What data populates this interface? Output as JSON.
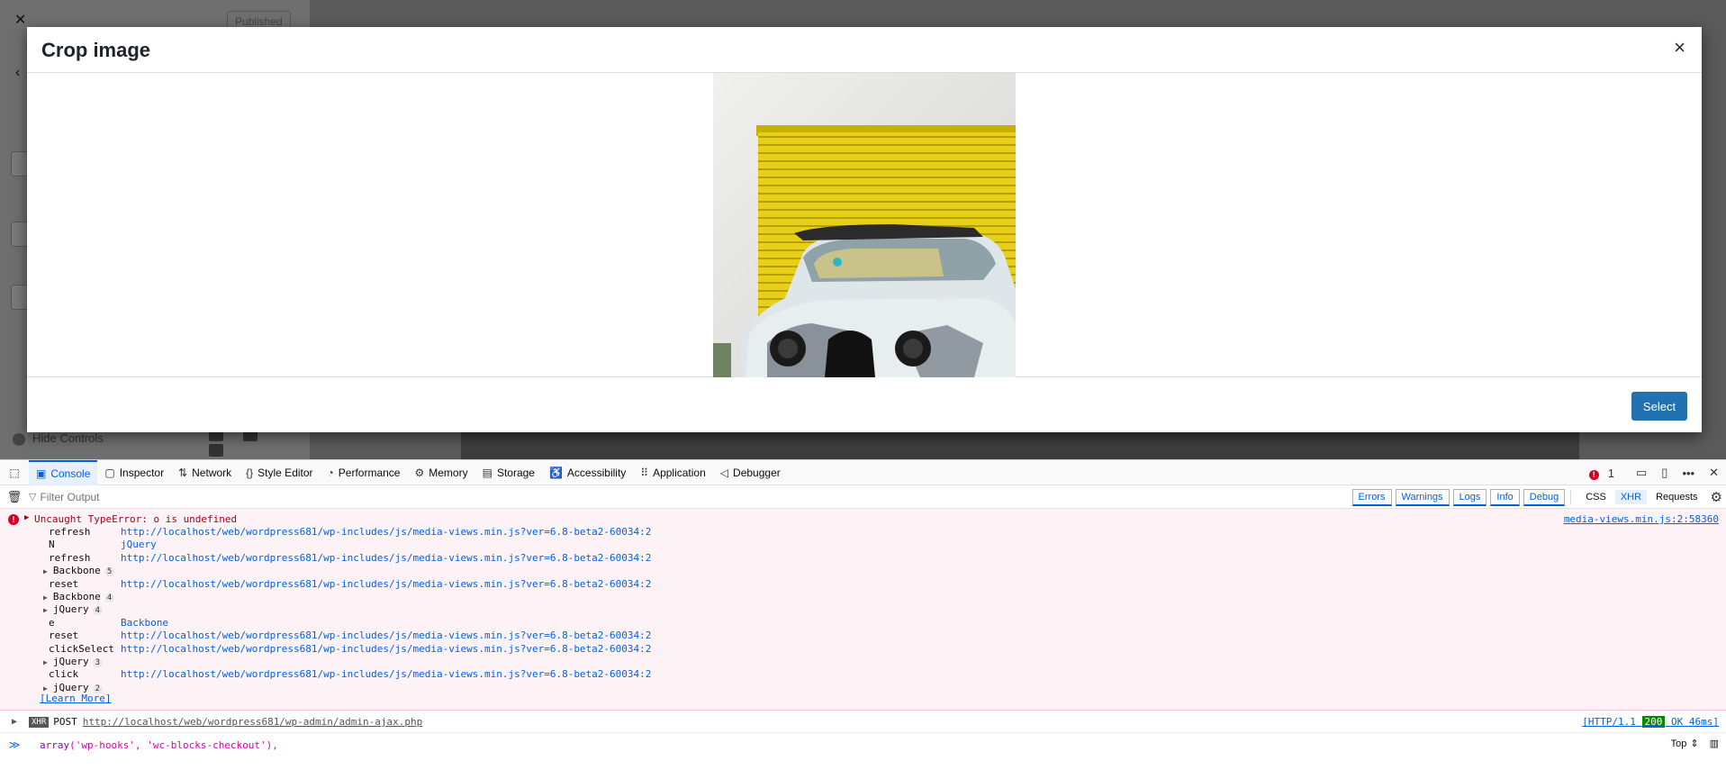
{
  "background": {
    "published_label": "Published",
    "hide_controls_label": "Hide Controls"
  },
  "modal": {
    "title": "Crop image",
    "close_symbol": "×",
    "select_label": "Select"
  },
  "devtools": {
    "tabs": [
      {
        "label": "Console",
        "icon": "console-icon"
      },
      {
        "label": "Inspector",
        "icon": "inspector-icon"
      },
      {
        "label": "Network",
        "icon": "network-icon"
      },
      {
        "label": "Style Editor",
        "icon": "style-editor-icon"
      },
      {
        "label": "Performance",
        "icon": "performance-icon"
      },
      {
        "label": "Memory",
        "icon": "memory-icon"
      },
      {
        "label": "Storage",
        "icon": "storage-icon"
      },
      {
        "label": "Accessibility",
        "icon": "accessibility-icon"
      },
      {
        "label": "Application",
        "icon": "application-icon"
      },
      {
        "label": "Debugger",
        "icon": "debugger-icon"
      }
    ],
    "error_count": "1",
    "filter_placeholder": "Filter Output",
    "filters": [
      "Errors",
      "Warnings",
      "Logs",
      "Info",
      "Debug"
    ],
    "extra_filters": [
      "CSS",
      "XHR",
      "Requests"
    ],
    "error": {
      "message": "Uncaught TypeError: o is undefined",
      "location": "media-views.min.js:2:58360",
      "frames": [
        {
          "fn": "refresh",
          "src": "http://localhost/web/wordpress681/wp-includes/js/media-views.min.js?ver=6.8-beta2-60034:2"
        },
        {
          "fn": "N",
          "src": "jQuery"
        },
        {
          "fn": "refresh",
          "src": "http://localhost/web/wordpress681/wp-includes/js/media-views.min.js?ver=6.8-beta2-60034:2"
        },
        {
          "group": "Backbone",
          "count": "5"
        },
        {
          "fn": "reset",
          "src": "http://localhost/web/wordpress681/wp-includes/js/media-views.min.js?ver=6.8-beta2-60034:2"
        },
        {
          "group": "Backbone",
          "count": "4"
        },
        {
          "group": "jQuery",
          "count": "4"
        },
        {
          "fn": "e",
          "src": "Backbone"
        },
        {
          "fn": "reset",
          "src": "http://localhost/web/wordpress681/wp-includes/js/media-views.min.js?ver=6.8-beta2-60034:2"
        },
        {
          "fn": "clickSelect",
          "src": "http://localhost/web/wordpress681/wp-includes/js/media-views.min.js?ver=6.8-beta2-60034:2"
        },
        {
          "group": "jQuery",
          "count": "3"
        },
        {
          "fn": "click",
          "src": "http://localhost/web/wordpress681/wp-includes/js/media-views.min.js?ver=6.8-beta2-60034:2"
        },
        {
          "group": "jQuery",
          "count": "2"
        }
      ],
      "learn_more": "[Learn More]"
    },
    "xhr": {
      "badge": "XHR",
      "method": "POST",
      "url": "http://localhost/web/wordpress681/wp-admin/admin-ajax.php",
      "status_prefix": "[HTTP/1.1",
      "status_code": "200",
      "status_suffix": "OK 46ms]"
    },
    "input": {
      "fn": "array",
      "args": "('wp-hooks', 'wc-blocks-checkout'),",
      "context": "Top"
    }
  }
}
